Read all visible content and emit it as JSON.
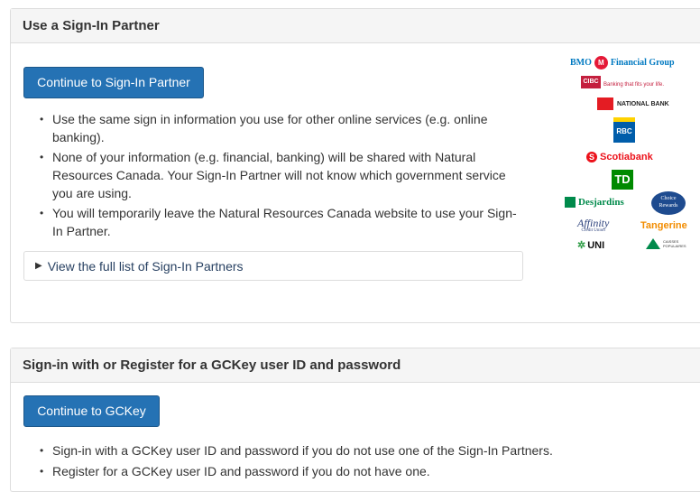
{
  "partner_section": {
    "heading": "Use a Sign-In Partner",
    "button_label": "Continue to Sign-In Partner",
    "bullets": [
      "Use the same sign in information you use for other online services (e.g. online banking).",
      "None of your information (e.g. financial, banking) will be shared with Natural Resources Canada. Your Sign-In Partner will not know which government service you are using.",
      "You will temporarily leave the Natural Resources Canada website to use your Sign-In Partner."
    ],
    "details_label": "View the full list of Sign-In Partners",
    "logos": {
      "bmo": "Financial Group",
      "bmo_name": "BMO",
      "cibc": "CIBC",
      "cibc_tag": "Banking that fits your life.",
      "national": "NATIONAL BANK",
      "rbc": "RBC",
      "scotia": "Scotiabank",
      "td": "TD",
      "desjardins": "Desjardins",
      "choice": "Choice Rewards",
      "affinity": "Affinity",
      "affinity_sub": "Credit Union",
      "tangerine": "Tangerine",
      "uni": "UNI",
      "caisses": "CAISSES POPULAIRES"
    }
  },
  "gckey_section": {
    "heading": "Sign-in with or Register for a GCKey user ID and password",
    "button_label": "Continue to GCKey",
    "bullets": [
      "Sign-in with a GCKey user ID and password if you do not use one of the Sign-In Partners.",
      "Register for a GCKey user ID and password if you do not have one."
    ]
  },
  "colors": {
    "button": "#2572b4",
    "panel_heading_bg": "#f5f5f5",
    "border": "#dddddd",
    "link": "#284162"
  }
}
